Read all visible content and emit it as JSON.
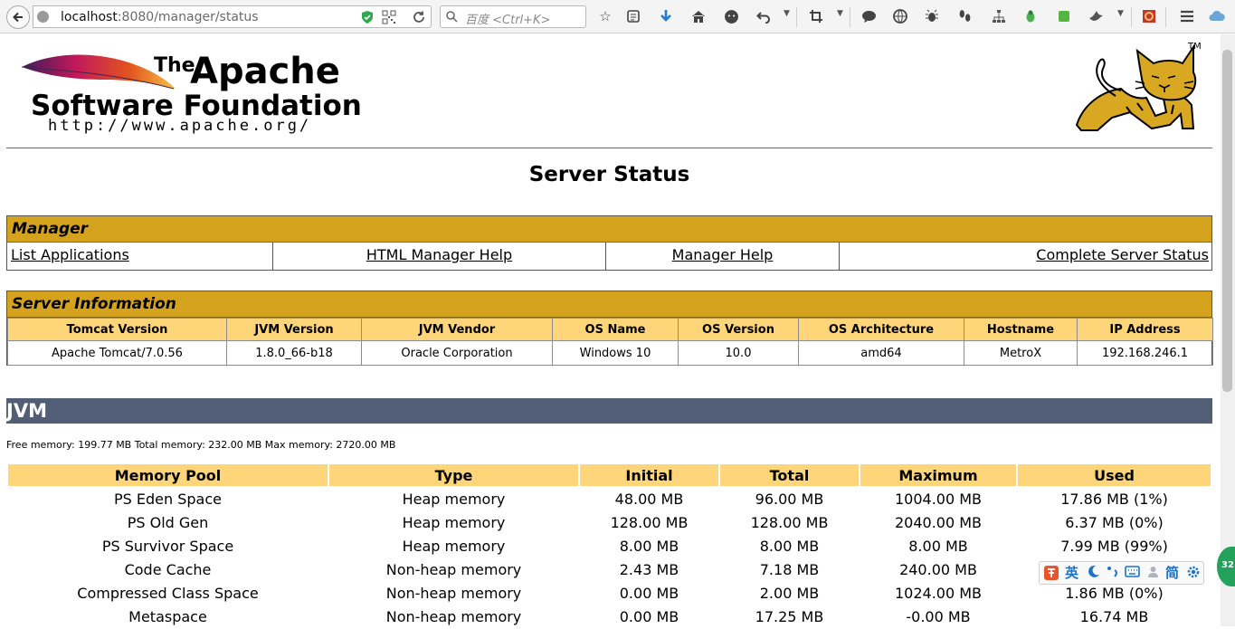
{
  "browser": {
    "url_host": "localhost",
    "url_path": ":8080/manager/status",
    "search_placeholder": "百度 <Ctrl+K>",
    "ime_items": [
      "英",
      "简"
    ],
    "badge_text": "32"
  },
  "logo": {
    "the": "The",
    "apache": "Apache",
    "software_foundation": "Software Foundation",
    "url": "http://www.apache.org/",
    "tm": "TM"
  },
  "page": {
    "title": "Server Status"
  },
  "manager": {
    "heading": "Manager",
    "links": [
      "List Applications",
      "HTML Manager Help",
      "Manager Help",
      "Complete Server Status"
    ]
  },
  "server_info": {
    "heading": "Server Information",
    "columns": [
      "Tomcat Version",
      "JVM Version",
      "JVM Vendor",
      "OS Name",
      "OS Version",
      "OS Architecture",
      "Hostname",
      "IP Address"
    ],
    "values": [
      "Apache Tomcat/7.0.56",
      "1.8.0_66-b18",
      "Oracle Corporation",
      "Windows 10",
      "10.0",
      "amd64",
      "MetroX",
      "192.168.246.1"
    ]
  },
  "jvm": {
    "heading": "JVM",
    "memory_summary": "Free memory: 199.77 MB Total memory: 232.00 MB Max memory: 2720.00 MB",
    "columns": [
      "Memory Pool",
      "Type",
      "Initial",
      "Total",
      "Maximum",
      "Used"
    ],
    "rows": [
      [
        "PS Eden Space",
        "Heap memory",
        "48.00 MB",
        "96.00 MB",
        "1004.00 MB",
        "17.86 MB (1%)"
      ],
      [
        "PS Old Gen",
        "Heap memory",
        "128.00 MB",
        "128.00 MB",
        "2040.00 MB",
        "6.37 MB (0%)"
      ],
      [
        "PS Survivor Space",
        "Heap memory",
        "8.00 MB",
        "8.00 MB",
        "8.00 MB",
        "7.99 MB (99%)"
      ],
      [
        "Code Cache",
        "Non-heap memory",
        "2.43 MB",
        "7.18 MB",
        "240.00 MB",
        ""
      ],
      [
        "Compressed Class Space",
        "Non-heap memory",
        "0.00 MB",
        "2.00 MB",
        "1024.00 MB",
        "1.86 MB (0%)"
      ],
      [
        "Metaspace",
        "Non-heap memory",
        "0.00 MB",
        "17.25 MB",
        "-0.00 MB",
        "16.74 MB"
      ]
    ]
  },
  "colors": {
    "section_head": "#d4a21c",
    "table_header": "#fed679",
    "jvm_bar": "#525d76"
  }
}
